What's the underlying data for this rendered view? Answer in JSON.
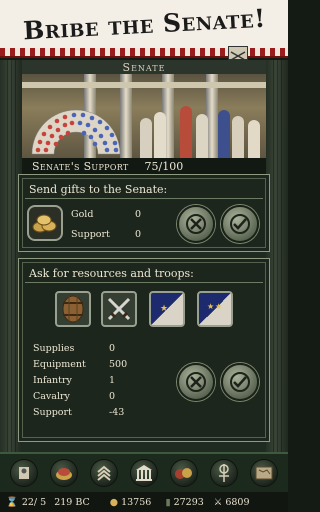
{
  "banner": {
    "title": "Bribe the Senate!"
  },
  "senate": {
    "title": "Senate",
    "support_label": "Senate's Support",
    "support_value": "75/100"
  },
  "gifts": {
    "header": "Send gifts to the Senate:",
    "rows": [
      {
        "label": "Gold",
        "value": "0"
      },
      {
        "label": "Support",
        "value": "0"
      }
    ]
  },
  "resources": {
    "header": "Ask for resources and troops:",
    "rows": [
      {
        "label": "Supplies",
        "value": "0"
      },
      {
        "label": "Equipment",
        "value": "500"
      },
      {
        "label": "Infantry",
        "value": "1"
      },
      {
        "label": "Cavalry",
        "value": "0"
      },
      {
        "label": "Support",
        "value": "-43"
      }
    ]
  },
  "toolbar_icons": [
    "general-icon",
    "treasure-icon",
    "rank-chevrons-icon",
    "senate-building-icon",
    "trade-goods-icon",
    "standard-icon",
    "map-icon"
  ],
  "status": {
    "turn": "22/ 5",
    "year": "219 BC",
    "gold": "13756",
    "resource": "27293",
    "troops": "6809"
  }
}
